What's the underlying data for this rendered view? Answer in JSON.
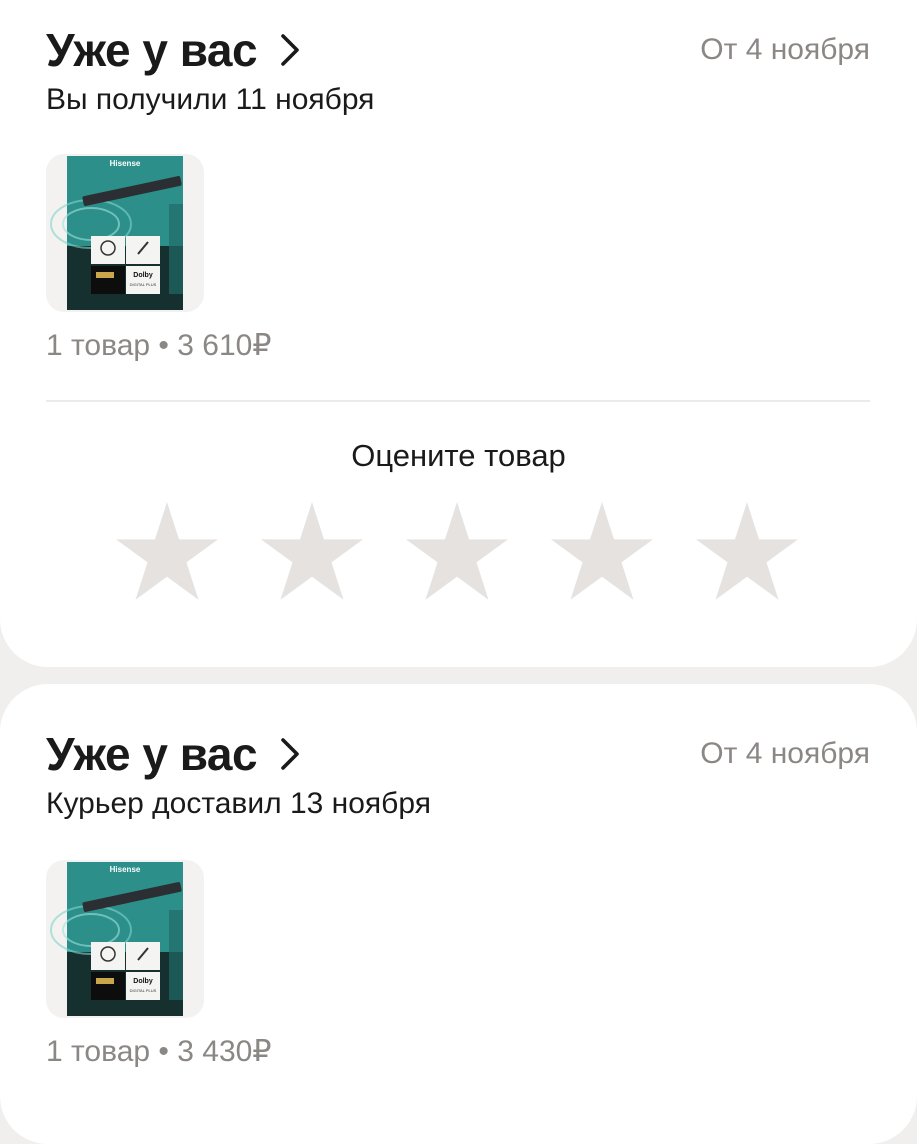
{
  "orders": [
    {
      "title": "Уже у вас",
      "date_range": "От 4 ноября",
      "status": "Вы получили 11 ноября",
      "summary": "1 товар • 3 610₽",
      "product_image": {
        "brand": "Hisense",
        "badge": "Dolby",
        "badge_sub": "DIGITAL PLUS"
      }
    },
    {
      "title": "Уже у вас",
      "date_range": "От 4 ноября",
      "status": "Курьер доставил 13 ноября",
      "summary": "1 товар • 3 430₽",
      "product_image": {
        "brand": "Hisense",
        "badge": "Dolby",
        "badge_sub": "DIGITAL PLUS"
      }
    }
  ],
  "rating": {
    "label": "Оцените товар",
    "max_stars": 5,
    "selected": 0,
    "star_color": "#e6e2df"
  },
  "colors": {
    "background": "#f0efed",
    "card": "#ffffff",
    "muted_text": "#8a8784",
    "primary_text": "#1a1a1a"
  }
}
